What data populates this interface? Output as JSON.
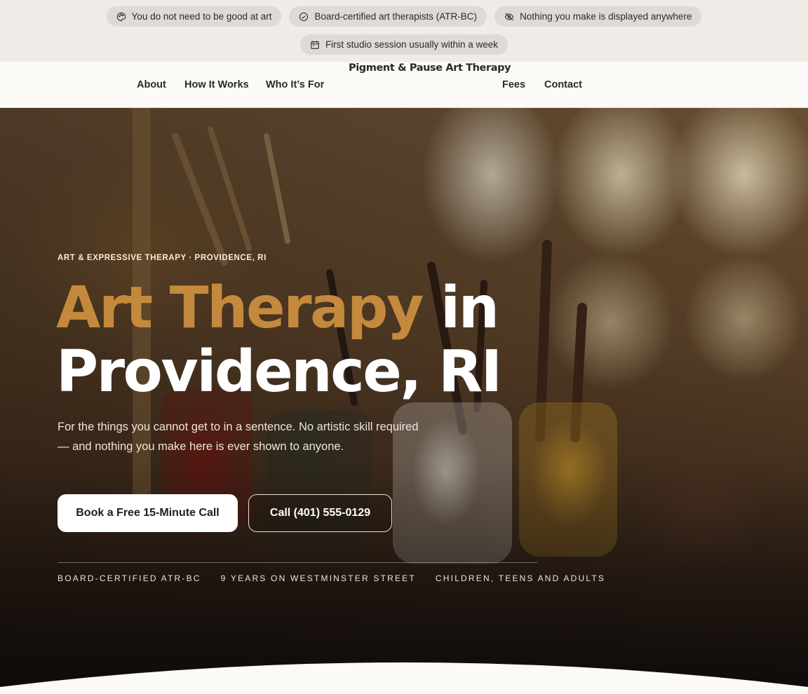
{
  "trust_pills": [
    {
      "icon": "palette-icon",
      "text": "You do not need to be good at art"
    },
    {
      "icon": "badge-check-icon",
      "text": "Board-certified art therapists (ATR-BC)"
    },
    {
      "icon": "eye-off-icon",
      "text": "Nothing you make is displayed anywhere"
    },
    {
      "icon": "calendar-icon",
      "text": "First studio session usually within a week"
    }
  ],
  "nav": {
    "links": [
      "About",
      "How It Works",
      "Who It’s For",
      "Fees",
      "Contact"
    ],
    "brand": "Pigment & Pause Art Therapy"
  },
  "hero": {
    "eyebrow": "ART & EXPRESSIVE THERAPY · PROVIDENCE, RI",
    "headline_accent": "Art Therapy",
    "headline_rest_1": " in",
    "headline_rest_2": "Providence, RI",
    "subtitle": "For the things you cannot get to in a sentence. No artistic skill required — and nothing you make here is ever shown to anyone.",
    "primary_cta": "Book a Free 15-Minute Call",
    "secondary_cta": "Call (401) 555-0129",
    "stats": [
      "BOARD-CERTIFIED ATR-BC",
      "9 YEARS ON WESTMINSTER STREET",
      "CHILDREN, TEENS AND ADULTS"
    ]
  },
  "colors": {
    "accent": "#c4893c",
    "brand": "#233f8f",
    "pill_bg": "#dedbd6",
    "page_bg": "#fbfaf7"
  }
}
